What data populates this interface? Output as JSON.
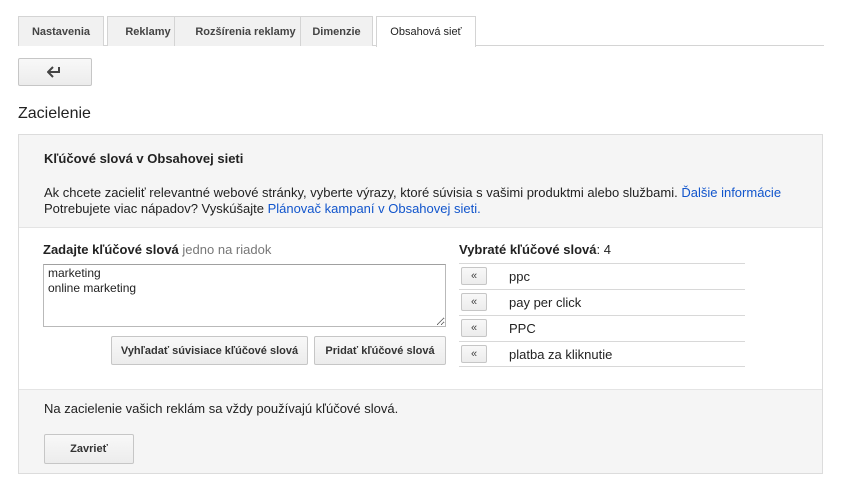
{
  "tabs": [
    {
      "label": "Nastavenia",
      "active": false
    },
    {
      "label": "Reklamy",
      "active": false
    },
    {
      "label": "Rozšírenia reklamy",
      "active": false
    },
    {
      "label": "Dimenzie",
      "active": false
    },
    {
      "label": "Obsahová sieť",
      "active": true
    }
  ],
  "back_button": {
    "icon": "back-arrow-icon"
  },
  "section": {
    "title": "Zacielenie"
  },
  "panel": {
    "title": "Kľúčové slová v Obsahovej sieti",
    "desc_line1": "Ak chcete zacieliť relevantné webové stránky, vyberte výrazy, ktoré súvisia s vašimi produktmi alebo službami.",
    "desc_link1": "Ďalšie informácie",
    "desc_line2": "Potrebujete viac nápadov? Vyskúšajte",
    "desc_link2": "Plánovač kampaní v Obsahovej sieti."
  },
  "entry": {
    "label": "Zadajte kľúčové slová",
    "hint": "jedno na riadok",
    "value": "marketing\nonline marketing",
    "search_related_label": "Vyhľadať súvisiace kľúčové slová",
    "add_label": "Pridať kľúčové slová"
  },
  "selected": {
    "label": "Vybraté kľúčové slová",
    "count": "4",
    "remove_glyph": "«",
    "keywords": [
      "ppc",
      "pay per click",
      "PPC",
      "platba za kliknutie"
    ]
  },
  "footer": {
    "note": "Na zacielenie vašich reklám sa vždy používajú kľúčové slová.",
    "close_label": "Zavrieť"
  }
}
